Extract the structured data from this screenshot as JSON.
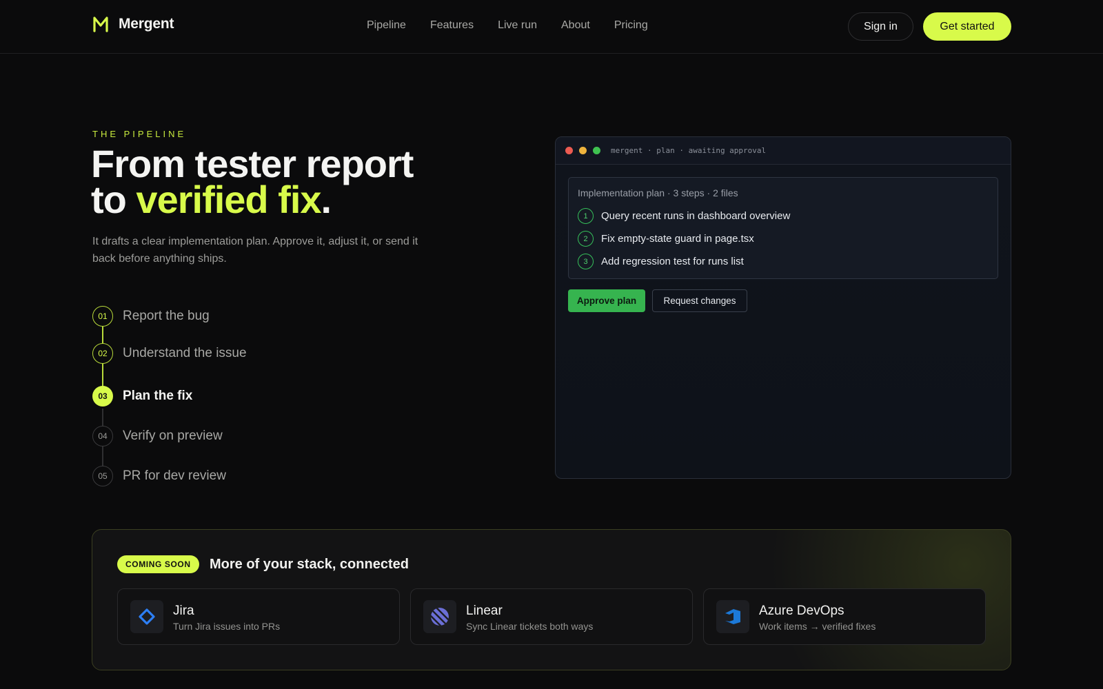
{
  "nav": {
    "brand": "Mergent",
    "links": [
      "Pipeline",
      "Features",
      "Live run",
      "About",
      "Pricing"
    ],
    "sign_in": "Sign in",
    "get_started": "Get started"
  },
  "hero": {
    "eyebrow": "THE PIPELINE",
    "headline_line1": "From tester report",
    "headline_line2_prefix": "to ",
    "headline_line2_accent": "verified fix",
    "headline_line2_suffix": ".",
    "subcopy": "It drafts a clear implementation plan. Approve it, adjust it, or send it back before anything ships."
  },
  "steps": [
    {
      "num": "01",
      "label": "Report the bug",
      "state": "done"
    },
    {
      "num": "02",
      "label": "Understand the issue",
      "state": "done"
    },
    {
      "num": "03",
      "label": "Plan the fix",
      "state": "active"
    },
    {
      "num": "04",
      "label": "Verify on preview",
      "state": "todo"
    },
    {
      "num": "05",
      "label": "PR for dev review",
      "state": "todo"
    }
  ],
  "terminal": {
    "title": "mergent · plan · awaiting approval",
    "plan_header": "Implementation plan · 3 steps · 2 files",
    "plan_steps": [
      {
        "num": "1",
        "text": "Query recent runs in dashboard overview"
      },
      {
        "num": "2",
        "text": "Fix empty-state guard in page.tsx"
      },
      {
        "num": "3",
        "text": "Add regression test for runs list"
      }
    ],
    "approve": "Approve plan",
    "request": "Request changes"
  },
  "integrations": {
    "badge": "COMING SOON",
    "title": "More of your stack, connected",
    "items": [
      {
        "name": "Jira",
        "desc": "Turn Jira issues into PRs",
        "icon": "jira-icon"
      },
      {
        "name": "Linear",
        "desc": "Sync Linear tickets both ways",
        "icon": "linear-icon"
      },
      {
        "name": "Azure DevOps",
        "desc": "Work items → verified fixes",
        "icon": "azure-devops-icon"
      }
    ]
  },
  "colors": {
    "accent": "#d8fa4a",
    "background": "#0b0b0c",
    "approve_green": "#36b44f"
  }
}
